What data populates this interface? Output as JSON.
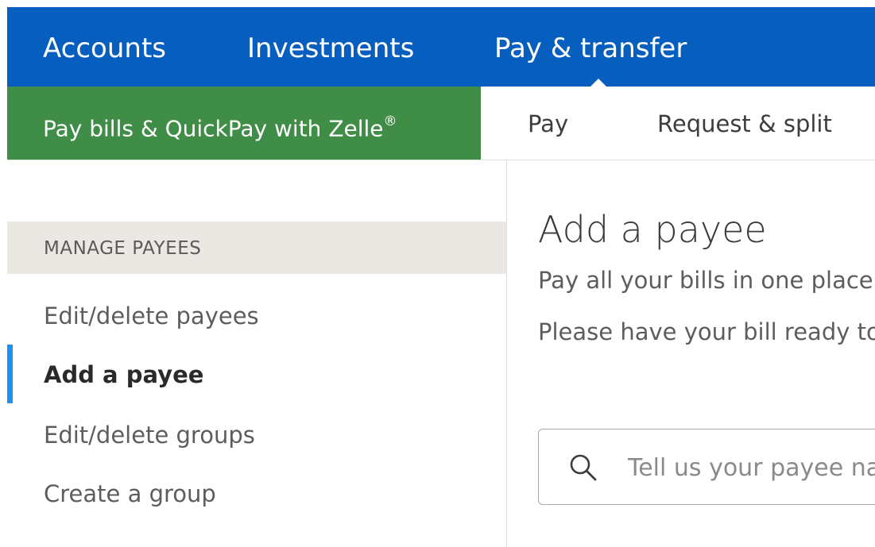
{
  "topnav": {
    "items": [
      {
        "label": "Accounts"
      },
      {
        "label": "Investments"
      },
      {
        "label": "Pay & transfer"
      }
    ]
  },
  "subnav": {
    "zelle_label": "Pay bills & QuickPay with Zelle",
    "zelle_mark": "®",
    "tabs": [
      {
        "label": "Pay"
      },
      {
        "label": "Request & split"
      }
    ]
  },
  "sidebar": {
    "header": "MANAGE PAYEES",
    "items": [
      {
        "label": "Edit/delete payees"
      },
      {
        "label": "Add a payee"
      },
      {
        "label": "Edit/delete groups"
      },
      {
        "label": "Create a group"
      }
    ]
  },
  "main": {
    "title": "Add a payee",
    "line1": "Pay all your bills in one place.",
    "line2": "Please have your bill ready to",
    "search_placeholder": "Tell us your payee name"
  },
  "colors": {
    "nav_blue": "#065ebf",
    "zelle_green": "#3f8d47",
    "active_accent": "#1f8ff0"
  },
  "icons": {
    "search": "search-icon"
  }
}
